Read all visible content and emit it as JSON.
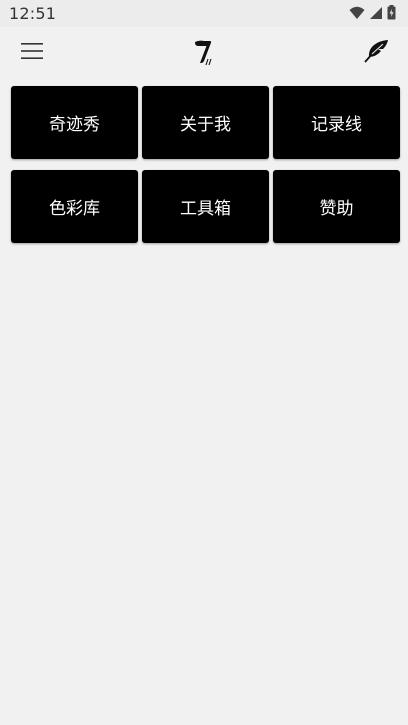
{
  "status_bar": {
    "time": "12:51",
    "icons": [
      "wifi-icon",
      "signal-icon",
      "battery-icon"
    ]
  },
  "app_bar": {
    "menu_icon": "hamburger-menu-icon",
    "logo_icon": "seven-logo-icon",
    "action_icon": "feather-icon"
  },
  "tiles": [
    {
      "label": "奇迹秀"
    },
    {
      "label": "关于我"
    },
    {
      "label": "记录线"
    },
    {
      "label": "色彩库"
    },
    {
      "label": "工具箱"
    },
    {
      "label": "赞助"
    }
  ],
  "colors": {
    "background": "#f1f1f1",
    "status_bar": "#ececec",
    "tile": "#000000",
    "tile_text": "#ffffff"
  }
}
